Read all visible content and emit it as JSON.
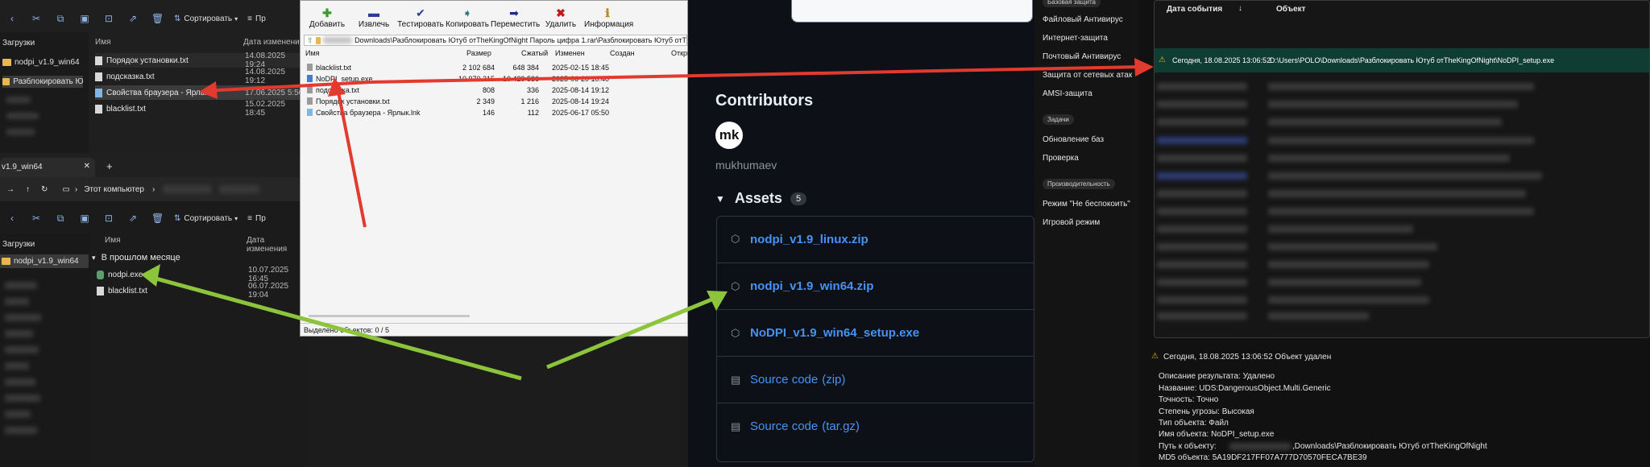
{
  "explorer_top": {
    "toolbar": {
      "sort_label": "Сортировать",
      "more_label": "Пр"
    },
    "columns": {
      "name": "Имя",
      "date": "Дата изменени"
    },
    "sidebar": [
      "Загрузки",
      "nodpi_v1.9_win64",
      "Разблокировать Ютуб"
    ],
    "files": [
      {
        "name": "Порядок установки.txt",
        "date": "14.08.2025 19:24"
      },
      {
        "name": "подсказка.txt",
        "date": "14.08.2025 19:12"
      },
      {
        "name": "Свойства браузера - Ярлык",
        "date": "17.06.2025 5:50"
      },
      {
        "name": "blacklist.txt",
        "date": "15.02.2025 18:45"
      }
    ]
  },
  "explorer_bottom": {
    "tab_title": "v1.9_win64",
    "address": "Этот компьютер",
    "toolbar": {
      "sort_label": "Сортировать",
      "more_label": "Пр"
    },
    "columns": {
      "name": "Имя",
      "date": "Дата изменения"
    },
    "sidebar": [
      "Загрузки",
      "nodpi_v1.9_win64"
    ],
    "group_label": "В прошлом месяце",
    "files": [
      {
        "name": "nodpi.exe",
        "date": "10.07.2025 16:45"
      },
      {
        "name": "blacklist.txt",
        "date": "06.07.2025 19:04"
      }
    ]
  },
  "archive": {
    "tools": [
      {
        "label": "Добавить",
        "icon": "plus-icon"
      },
      {
        "label": "Извлечь",
        "icon": "minus-icon"
      },
      {
        "label": "Тестировать",
        "icon": "check-icon"
      },
      {
        "label": "Копировать",
        "icon": "copy-arrow-icon"
      },
      {
        "label": "Переместить",
        "icon": "move-arrow-icon"
      },
      {
        "label": "Удалить",
        "icon": "delete-x-icon"
      },
      {
        "label": "Информация",
        "icon": "info-icon"
      }
    ],
    "path": "Downloads\\Разблокировать Ютуб отTheKingOfNight Пароль цифра 1.rar\\Разблокировать Ютуб отT",
    "columns": {
      "name": "Имя",
      "size": "Размер",
      "packed": "Сжатый",
      "modified": "Изменен",
      "created": "Создан",
      "opened": "Откры"
    },
    "rows": [
      {
        "name": "blacklist.txt",
        "size": "2 102 684",
        "packed": "648 384",
        "modified": "2025-02-15 18:45"
      },
      {
        "name": "NoDPI_setup.exe",
        "size": "10 970 215",
        "packed": "10 429 536",
        "modified": "2025-06-20 10:40"
      },
      {
        "name": "подсказка.txt",
        "size": "808",
        "packed": "336",
        "modified": "2025-08-14 19:12"
      },
      {
        "name": "Порядок установки.txt",
        "size": "2 349",
        "packed": "1 216",
        "modified": "2025-08-14 19:24"
      },
      {
        "name": "Свойства браузера - Ярлык.lnk",
        "size": "146",
        "packed": "112",
        "modified": "2025-06-17 05:50"
      }
    ],
    "status": "Выделено объектов: 0 / 5"
  },
  "github": {
    "contributors_title": "Contributors",
    "avatar_initials": "mk",
    "contributor_name": "mukhumaev",
    "assets_title": "Assets",
    "assets_count": "5",
    "assets": [
      {
        "label": "nodpi_v1.9_linux.zip"
      },
      {
        "label": "nodpi_v1.9_win64.zip"
      },
      {
        "label": "NoDPI_v1.9_win64_setup.exe"
      },
      {
        "label": "Source code",
        "suffix": "(zip)"
      },
      {
        "label": "Source code",
        "suffix": "(tar.gz)"
      }
    ]
  },
  "antivirus": {
    "section_top": "Базовая защита",
    "menu": [
      "Файловый Антивирус",
      "Интернет-защита",
      "Почтовый Антивирус",
      "Защита от сетевых атак",
      "AMSI-защита"
    ],
    "section_tasks": "Задачи",
    "tasks": [
      "Обновление баз",
      "Проверка"
    ],
    "section_perf": "Производительность",
    "perf": [
      "Режим \"Не беспокоить\"",
      "Игровой режим"
    ],
    "table_headers": {
      "date": "Дата события",
      "sort": "↓",
      "object": "Объект"
    },
    "highlight_event": {
      "date": "Сегодня, 18.08.2025 13:06:52",
      "object": "D:\\Users\\POLO\\Downloads\\Разблокировать Ютуб отTheKingOfNight\\NoDPI_setup.exe"
    },
    "detail_header": "Сегодня, 18.08.2025 13:06:52 Объект удален",
    "details": [
      "Описание результата: Удалено",
      "Название: UDS:DangerousObject.Multi.Generic",
      "Точность: Точно",
      "Степень угрозы: Высокая",
      "Тип объекта: Файл",
      "Имя объекта: NoDPI_setup.exe",
      "Путь к объекту:",
      "MD5 объекта: 5A19DF217FF07A777D70570FECA7BE39"
    ],
    "path_tail": ",Downloads\\Разблокировать Ютуб отTheKingOfNight"
  },
  "colors": {
    "arrow_red": "#e23a2e",
    "arrow_green": "#8cc43c",
    "link_blue": "#4493f8",
    "highlight_row": "#0f3d33"
  }
}
